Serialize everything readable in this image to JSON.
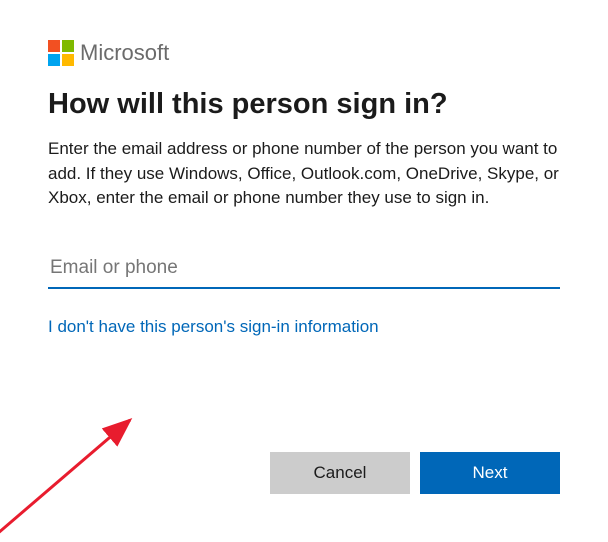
{
  "brand": {
    "name": "Microsoft",
    "logo_colors": [
      "#f25022",
      "#7fba00",
      "#00a4ef",
      "#ffb900"
    ]
  },
  "dialog": {
    "heading": "How will this person sign in?",
    "description": "Enter the email address or phone number of the person you want to add. If they use Windows, Office, Outlook.com, OneDrive, Skype, or Xbox, enter the email or phone number they use to sign in.",
    "input": {
      "placeholder": "Email or phone",
      "value": ""
    },
    "no_info_link": "I don't have this person's sign-in information",
    "buttons": {
      "cancel": "Cancel",
      "next": "Next"
    }
  },
  "colors": {
    "accent": "#0067b8",
    "secondary_button_bg": "#cccccc"
  }
}
